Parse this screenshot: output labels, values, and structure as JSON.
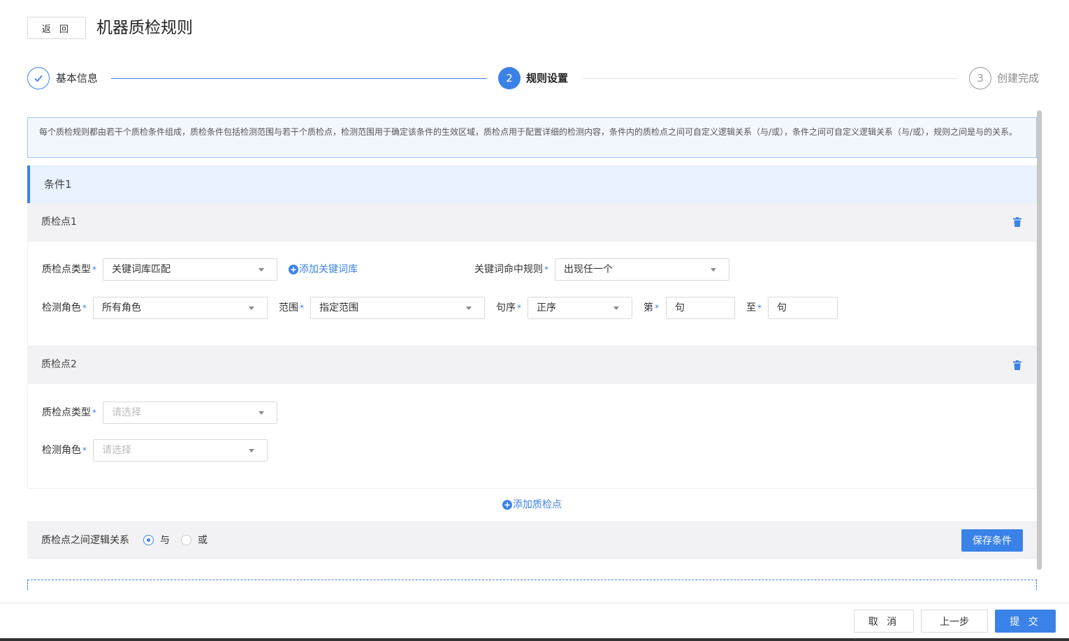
{
  "header": {
    "back_label": "返 回",
    "title": "机器质检规则"
  },
  "steps": [
    {
      "index": "1",
      "label": "基本信息",
      "state": "done"
    },
    {
      "index": "2",
      "label": "规则设置",
      "state": "active"
    },
    {
      "index": "3",
      "label": "创建完成",
      "state": "pending"
    }
  ],
  "info_text": "每个质检规则都由若干个质检条件组成，质检条件包括检测范围与若干个质检点，检测范围用于确定该条件的生效区域，质检点用于配置详细的检测内容，条件内的质检点之间可自定义逻辑关系（与/或），条件之间可自定义逻辑关系（与/或），规则之间是与的关系。",
  "condition": {
    "title": "条件1",
    "points": [
      {
        "title": "质检点1",
        "type_label": "质检点类型",
        "type_value": "关键词库匹配",
        "add_keyword_lib": "添加关键词库",
        "hit_rule_label": "关键词命中规则",
        "hit_rule_value": "出现任一个",
        "role_label": "检测角色",
        "role_value": "所有角色",
        "range_label": "范围",
        "range_value": "指定范围",
        "order_label": "句序",
        "order_value": "正序",
        "from_label": "第",
        "from_unit": "句",
        "to_label": "至",
        "to_unit": "句"
      },
      {
        "title": "质检点2",
        "type_label": "质检点类型",
        "type_placeholder": "请选择",
        "role_label": "检测角色",
        "role_placeholder": "请选择"
      }
    ],
    "add_point_label": "添加质检点",
    "logic_label": "质检点之间逻辑关系",
    "logic_options": [
      "与",
      "或"
    ],
    "logic_selected": "与",
    "save_label": "保存条件"
  },
  "footer": {
    "cancel_label": "取 消",
    "prev_label": "上一步",
    "submit_label": "提 交"
  },
  "colors": {
    "accent": "#3b82e8",
    "info_bg": "#f2f7fe",
    "section_bg": "#f2f2f4"
  }
}
